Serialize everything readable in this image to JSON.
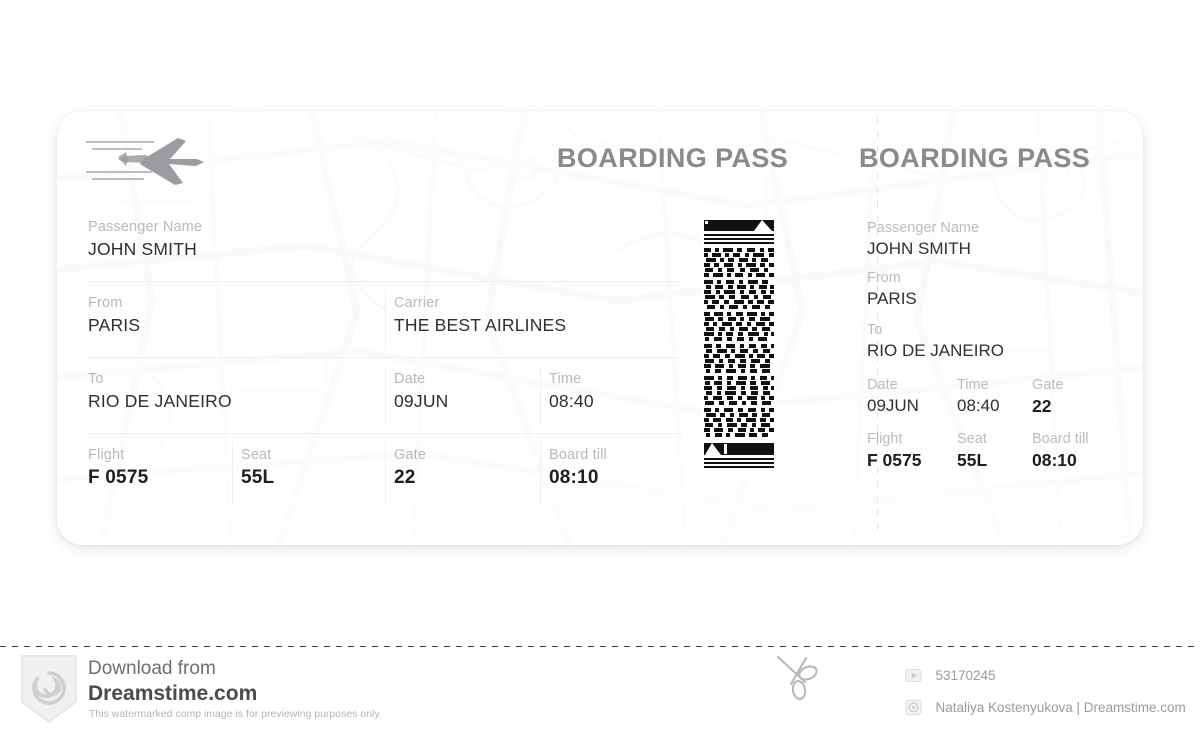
{
  "ticket": {
    "main_heading": "BOARDING PASS",
    "stub_heading": "BOARDING PASS",
    "logo_icon": "airplane-icon",
    "barcode_icon": "pdf417-barcode",
    "main_fields": {
      "passenger_label": "Passenger Name",
      "passenger_value": "JOHN SMITH",
      "from_label": "From",
      "from_value": "PARIS",
      "carrier_label": "Carrier",
      "carrier_value": "THE BEST AIRLINES",
      "to_label": "To",
      "to_value": "RIO DE JANEIRO",
      "date_label": "Date",
      "date_value": "09JUN",
      "time_label": "Time",
      "time_value": "08:40",
      "flight_label": "Flight",
      "flight_value": "F 0575",
      "seat_label": "Seat",
      "seat_value": "55L",
      "gate_label": "Gate",
      "gate_value": "22",
      "board_till_label": "Board till",
      "board_till_value": "08:10"
    },
    "stub_fields": {
      "passenger_label": "Passenger Name",
      "passenger_value": "JOHN SMITH",
      "from_label": "From",
      "from_value": "PARIS",
      "to_label": "To",
      "to_value": "RIO DE JANEIRO",
      "date_label": "Date",
      "date_value": "09JUN",
      "time_label": "Time",
      "time_value": "08:40",
      "gate_label": "Gate",
      "gate_value": "22",
      "flight_label": "Flight",
      "flight_value": "F 0575",
      "seat_label": "Seat",
      "seat_value": "55L",
      "board_till_label": "Board till",
      "board_till_value": "08:10"
    }
  },
  "footer": {
    "download_from": "Download from",
    "site": "Dreamstime.com",
    "note": "This watermarked comp image is for previewing purposes only.",
    "logo_icon": "dreamstime-spiral-logo",
    "scissors_icon": "scissors-icon",
    "image_id": "53170245",
    "image_id_icon": "image-id-icon",
    "author": "Nataliya Kostenyukova | Dreamstime.com",
    "author_icon": "author-icon"
  },
  "colors": {
    "label": "#b9b9bd",
    "value": "#2f2f33",
    "heading": "#8a8a8e",
    "card": "#fdfdfd",
    "rule": "#efeff1"
  }
}
